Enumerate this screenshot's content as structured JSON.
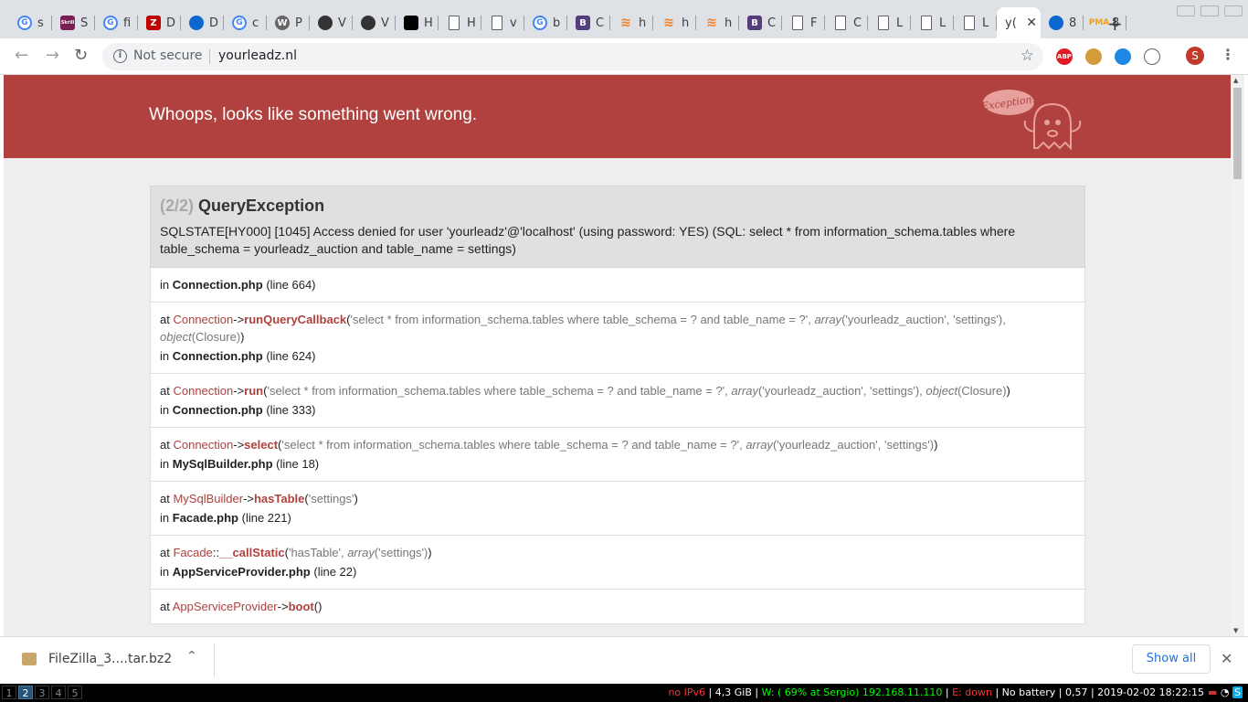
{
  "browser": {
    "tabs": [
      {
        "icon": "google-icon",
        "glyph": "G",
        "title": "s"
      },
      {
        "icon": "skrill-icon",
        "glyph": "Skrill",
        "title": "S"
      },
      {
        "icon": "google-icon",
        "glyph": "G",
        "title": "fi"
      },
      {
        "icon": "filezilla-icon",
        "glyph": "Z",
        "title": "D"
      },
      {
        "icon": "blue-circle-icon",
        "glyph": "",
        "title": "D"
      },
      {
        "icon": "google-icon",
        "glyph": "G",
        "title": "c"
      },
      {
        "icon": "wordpress-icon",
        "glyph": "W",
        "title": "P"
      },
      {
        "icon": "dark-circle-icon",
        "glyph": "",
        "title": "V"
      },
      {
        "icon": "dark-circle-icon",
        "glyph": "",
        "title": "V"
      },
      {
        "icon": "black-square-icon",
        "glyph": "",
        "title": "H"
      },
      {
        "icon": "document-icon",
        "glyph": "",
        "title": "H"
      },
      {
        "icon": "document-icon",
        "glyph": "",
        "title": "v"
      },
      {
        "icon": "google-icon",
        "glyph": "G",
        "title": "b"
      },
      {
        "icon": "bootstrap-icon",
        "glyph": "B",
        "title": "C"
      },
      {
        "icon": "stackoverflow-icon",
        "glyph": "≋",
        "title": "h"
      },
      {
        "icon": "stackoverflow-icon",
        "glyph": "≋",
        "title": "h"
      },
      {
        "icon": "stackoverflow-icon",
        "glyph": "≋",
        "title": "h"
      },
      {
        "icon": "bootstrap-icon",
        "glyph": "B",
        "title": "C"
      },
      {
        "icon": "document-icon",
        "glyph": "",
        "title": "F"
      },
      {
        "icon": "document-icon",
        "glyph": "",
        "title": "C"
      },
      {
        "icon": "document-icon",
        "glyph": "",
        "title": "L"
      },
      {
        "icon": "document-icon",
        "glyph": "",
        "title": "L"
      },
      {
        "icon": "document-icon",
        "glyph": "",
        "title": "L"
      },
      {
        "icon": "",
        "glyph": "",
        "title": "y(",
        "active": true
      },
      {
        "icon": "blue-circle-icon",
        "glyph": "",
        "title": "8"
      },
      {
        "icon": "phpmyadmin-icon",
        "glyph": "PMA",
        "title": "8"
      }
    ],
    "security_label": "Not secure",
    "url": "yourleadz.nl",
    "extensions": [
      "ABP",
      "cookie",
      "sync",
      "ext"
    ],
    "profile_initial": "S"
  },
  "whoops": {
    "title": "Whoops, looks like something went wrong.",
    "badge": "Exception!"
  },
  "exception": {
    "count": "(2/2)",
    "name": "QueryException",
    "message": "SQLSTATE[HY000] [1045] Access denied for user 'yourleadz'@'localhost' (using password: YES) (SQL: select * from information_schema.tables where table_schema = yourleadz_auction and table_name = settings)",
    "location": {
      "prefix": "in",
      "file": "Connection.php",
      "line": "(line 664)"
    }
  },
  "frames": [
    {
      "cls": "Connection",
      "op": "->",
      "fn": "runQueryCallback",
      "args": [
        {
          "t": "arg",
          "v": "'select * from information_schema.tables where table_schema = ? and table_name = ?', "
        },
        {
          "t": "kw",
          "v": "array"
        },
        {
          "t": "arg",
          "v": "('yourleadz_auction', 'settings'), "
        },
        {
          "t": "kw",
          "v": "object"
        },
        {
          "t": "arg",
          "v": "(Closure)"
        }
      ],
      "file": "Connection.php",
      "line": "(line 624)"
    },
    {
      "cls": "Connection",
      "op": "->",
      "fn": "run",
      "args": [
        {
          "t": "arg",
          "v": "'select * from information_schema.tables where table_schema = ? and table_name = ?', "
        },
        {
          "t": "kw",
          "v": "array"
        },
        {
          "t": "arg",
          "v": "('yourleadz_auction', 'settings'), "
        },
        {
          "t": "kw",
          "v": "object"
        },
        {
          "t": "arg",
          "v": "(Closure)"
        }
      ],
      "file": "Connection.php",
      "line": "(line 333)"
    },
    {
      "cls": "Connection",
      "op": "->",
      "fn": "select",
      "args": [
        {
          "t": "arg",
          "v": "'select * from information_schema.tables where table_schema = ? and table_name = ?', "
        },
        {
          "t": "kw",
          "v": "array"
        },
        {
          "t": "arg",
          "v": "('yourleadz_auction', 'settings')"
        }
      ],
      "file": "MySqlBuilder.php",
      "line": "(line 18)"
    },
    {
      "cls": "MySqlBuilder",
      "op": "->",
      "fn": "hasTable",
      "args": [
        {
          "t": "arg",
          "v": "'settings'"
        }
      ],
      "file": "Facade.php",
      "line": "(line 221)"
    },
    {
      "cls": "Facade",
      "op": "::",
      "fn": "__callStatic",
      "args": [
        {
          "t": "arg",
          "v": "'hasTable', "
        },
        {
          "t": "kw",
          "v": "array"
        },
        {
          "t": "arg",
          "v": "('settings')"
        }
      ],
      "file": "AppServiceProvider.php",
      "line": "(line 22)"
    },
    {
      "cls": "AppServiceProvider",
      "op": "->",
      "fn": "boot",
      "args": [],
      "file": "",
      "line": ""
    }
  ],
  "labels": {
    "at": "at",
    "in": "in",
    "open_paren": "(",
    "close_paren": ")"
  },
  "downloads": {
    "file_name": "FileZilla_3....tar.bz2",
    "show_all": "Show all"
  },
  "statusbar": {
    "workspaces": [
      "1",
      "2",
      "3",
      "4",
      "5"
    ],
    "active_workspace": "2",
    "ipv6": "no IPv6",
    "disk": "4,3 GiB",
    "wifi": "W: ( 69% at Sergio) 192.168.11.110",
    "ethernet": "E: down",
    "battery": "No battery",
    "load": "0,57",
    "datetime": "2019-02-02 18:22:15"
  },
  "colors": {
    "whoops_red": "#b0413e",
    "accent_blue": "#1a73e8",
    "status_green": "#00ff00",
    "status_red": "#ff3333"
  }
}
